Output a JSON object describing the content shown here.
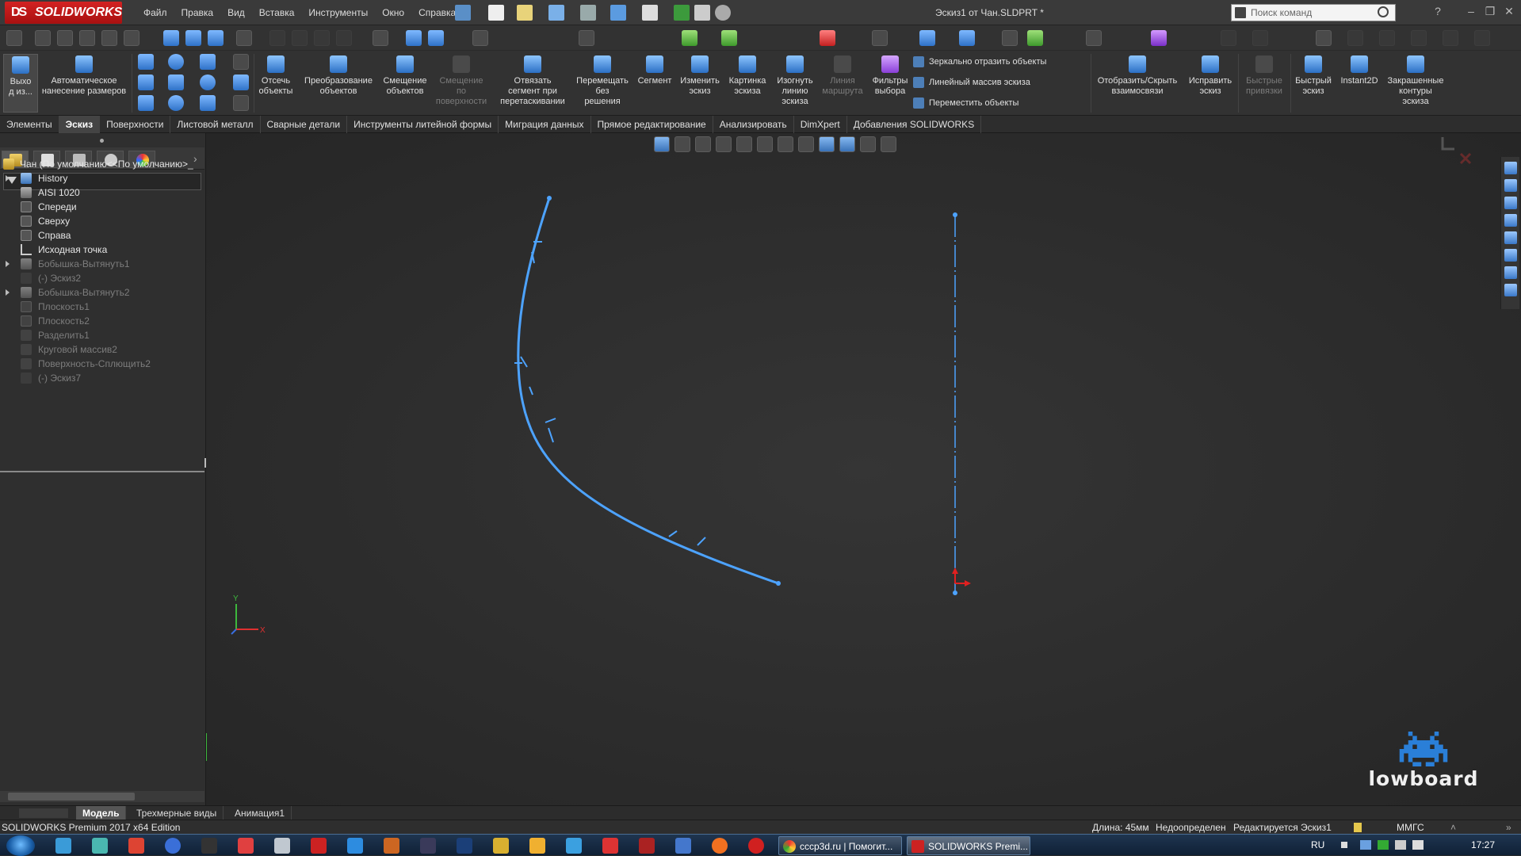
{
  "app": {
    "brand": "SOLIDWORKS",
    "title": "Эскиз1 от Чан.SLDPRT *"
  },
  "menu": [
    "Файл",
    "Правка",
    "Вид",
    "Вставка",
    "Инструменты",
    "Окно",
    "Справка"
  ],
  "search": {
    "placeholder": "Поиск команд"
  },
  "ribbon": {
    "exit_sketch": "Выхо\nд из...",
    "auto_dim": "Автоматическое\nнанесение размеров",
    "trim": "Отсечь\nобъекты",
    "convert": "Преобразование\nобъектов",
    "offset": "Смещение\nобъектов",
    "offset_surface": "Смещение\nпо\nповерхности",
    "detach": "Отвязать\nсегмент при\nперетаскивании",
    "move_nosolve": "Перемещать\nбез\nрешения",
    "segment": "Сегмент",
    "modify": "Изменить\nэскиз",
    "picture": "Картинка\nэскиза",
    "jog_line": "Изогнуть\nлинию\nэскиза",
    "route_line": "Линия\nмаршрута",
    "sel_filters": "Фильтры\nвыбора",
    "mirror": "Зеркально отразить объекты",
    "linear_pattern": "Линейный массив эскиза",
    "move_entities": "Переместить объекты",
    "show_relations": "Отобразить/Скрыть\nвзаимосвязи",
    "repair": "Исправить\nэскиз",
    "quick_snaps": "Быстрые\nпривязки",
    "rapid_sketch": "Быстрый\nэскиз",
    "instant2d": "Instant2D",
    "shaded_contours": "Закрашенные\nконтуры\nэскиза"
  },
  "tabs": [
    "Элементы",
    "Эскиз",
    "Поверхности",
    "Листовой металл",
    "Сварные детали",
    "Инструменты литейной формы",
    "Миграция данных",
    "Прямое редактирование",
    "Анализировать",
    "DimXpert",
    "Добавления SOLIDWORKS"
  ],
  "active_tab": "Эскиз",
  "tree": {
    "root": "Чан  (По умолчанию<<По умолчанию>_",
    "items": [
      {
        "label": "History",
        "icon": "history-icon",
        "expandable": true,
        "dim": false
      },
      {
        "label": "AISI 1020",
        "icon": "material-icon",
        "expandable": false,
        "dim": false
      },
      {
        "label": "Спереди",
        "icon": "plane-icon",
        "expandable": false,
        "dim": false
      },
      {
        "label": "Сверху",
        "icon": "plane-icon",
        "expandable": false,
        "dim": false
      },
      {
        "label": "Справа",
        "icon": "plane-icon",
        "expandable": false,
        "dim": false
      },
      {
        "label": "Исходная точка",
        "icon": "origin-icon",
        "expandable": false,
        "dim": false
      },
      {
        "label": "Бобышка-Вытянуть1",
        "icon": "extrude-icon",
        "expandable": true,
        "dim": true
      },
      {
        "label": "(-) Эскиз2",
        "icon": "sketch-icon",
        "expandable": false,
        "dim": true
      },
      {
        "label": "Бобышка-Вытянуть2",
        "icon": "extrude-icon",
        "expandable": true,
        "dim": true
      },
      {
        "label": "Плоскость1",
        "icon": "plane-icon",
        "expandable": false,
        "dim": true
      },
      {
        "label": "Плоскость2",
        "icon": "plane-icon",
        "expandable": false,
        "dim": true
      },
      {
        "label": "Разделить1",
        "icon": "split-icon",
        "expandable": false,
        "dim": true
      },
      {
        "label": "Круговой массив2",
        "icon": "circular-pattern-icon",
        "expandable": false,
        "dim": true
      },
      {
        "label": "Поверхность-Сплющить2",
        "icon": "flatten-icon",
        "expandable": false,
        "dim": true
      },
      {
        "label": "(-) Эскиз7",
        "icon": "sketch-icon",
        "expandable": false,
        "dim": true
      }
    ]
  },
  "model_tabs": [
    "Модель",
    "Трехмерные виды",
    "Анимация1"
  ],
  "status": {
    "edition": "SOLIDWORKS Premium 2017 x64 Edition",
    "length": "Длина: 45мм",
    "defined": "Недоопределен",
    "editing": "Редактируется Эскиз1",
    "units": "ММГС"
  },
  "taskbar": {
    "tasks": [
      "cccp3d.ru | Помогит...",
      "SOLIDWORKS Premi..."
    ],
    "lang": "RU",
    "clock": "17:27"
  },
  "watermark": "lowboard",
  "axis": {
    "x": "X",
    "y": "Y"
  },
  "colors": {
    "sketch": "#4da3ff",
    "accent": "#d32222"
  }
}
